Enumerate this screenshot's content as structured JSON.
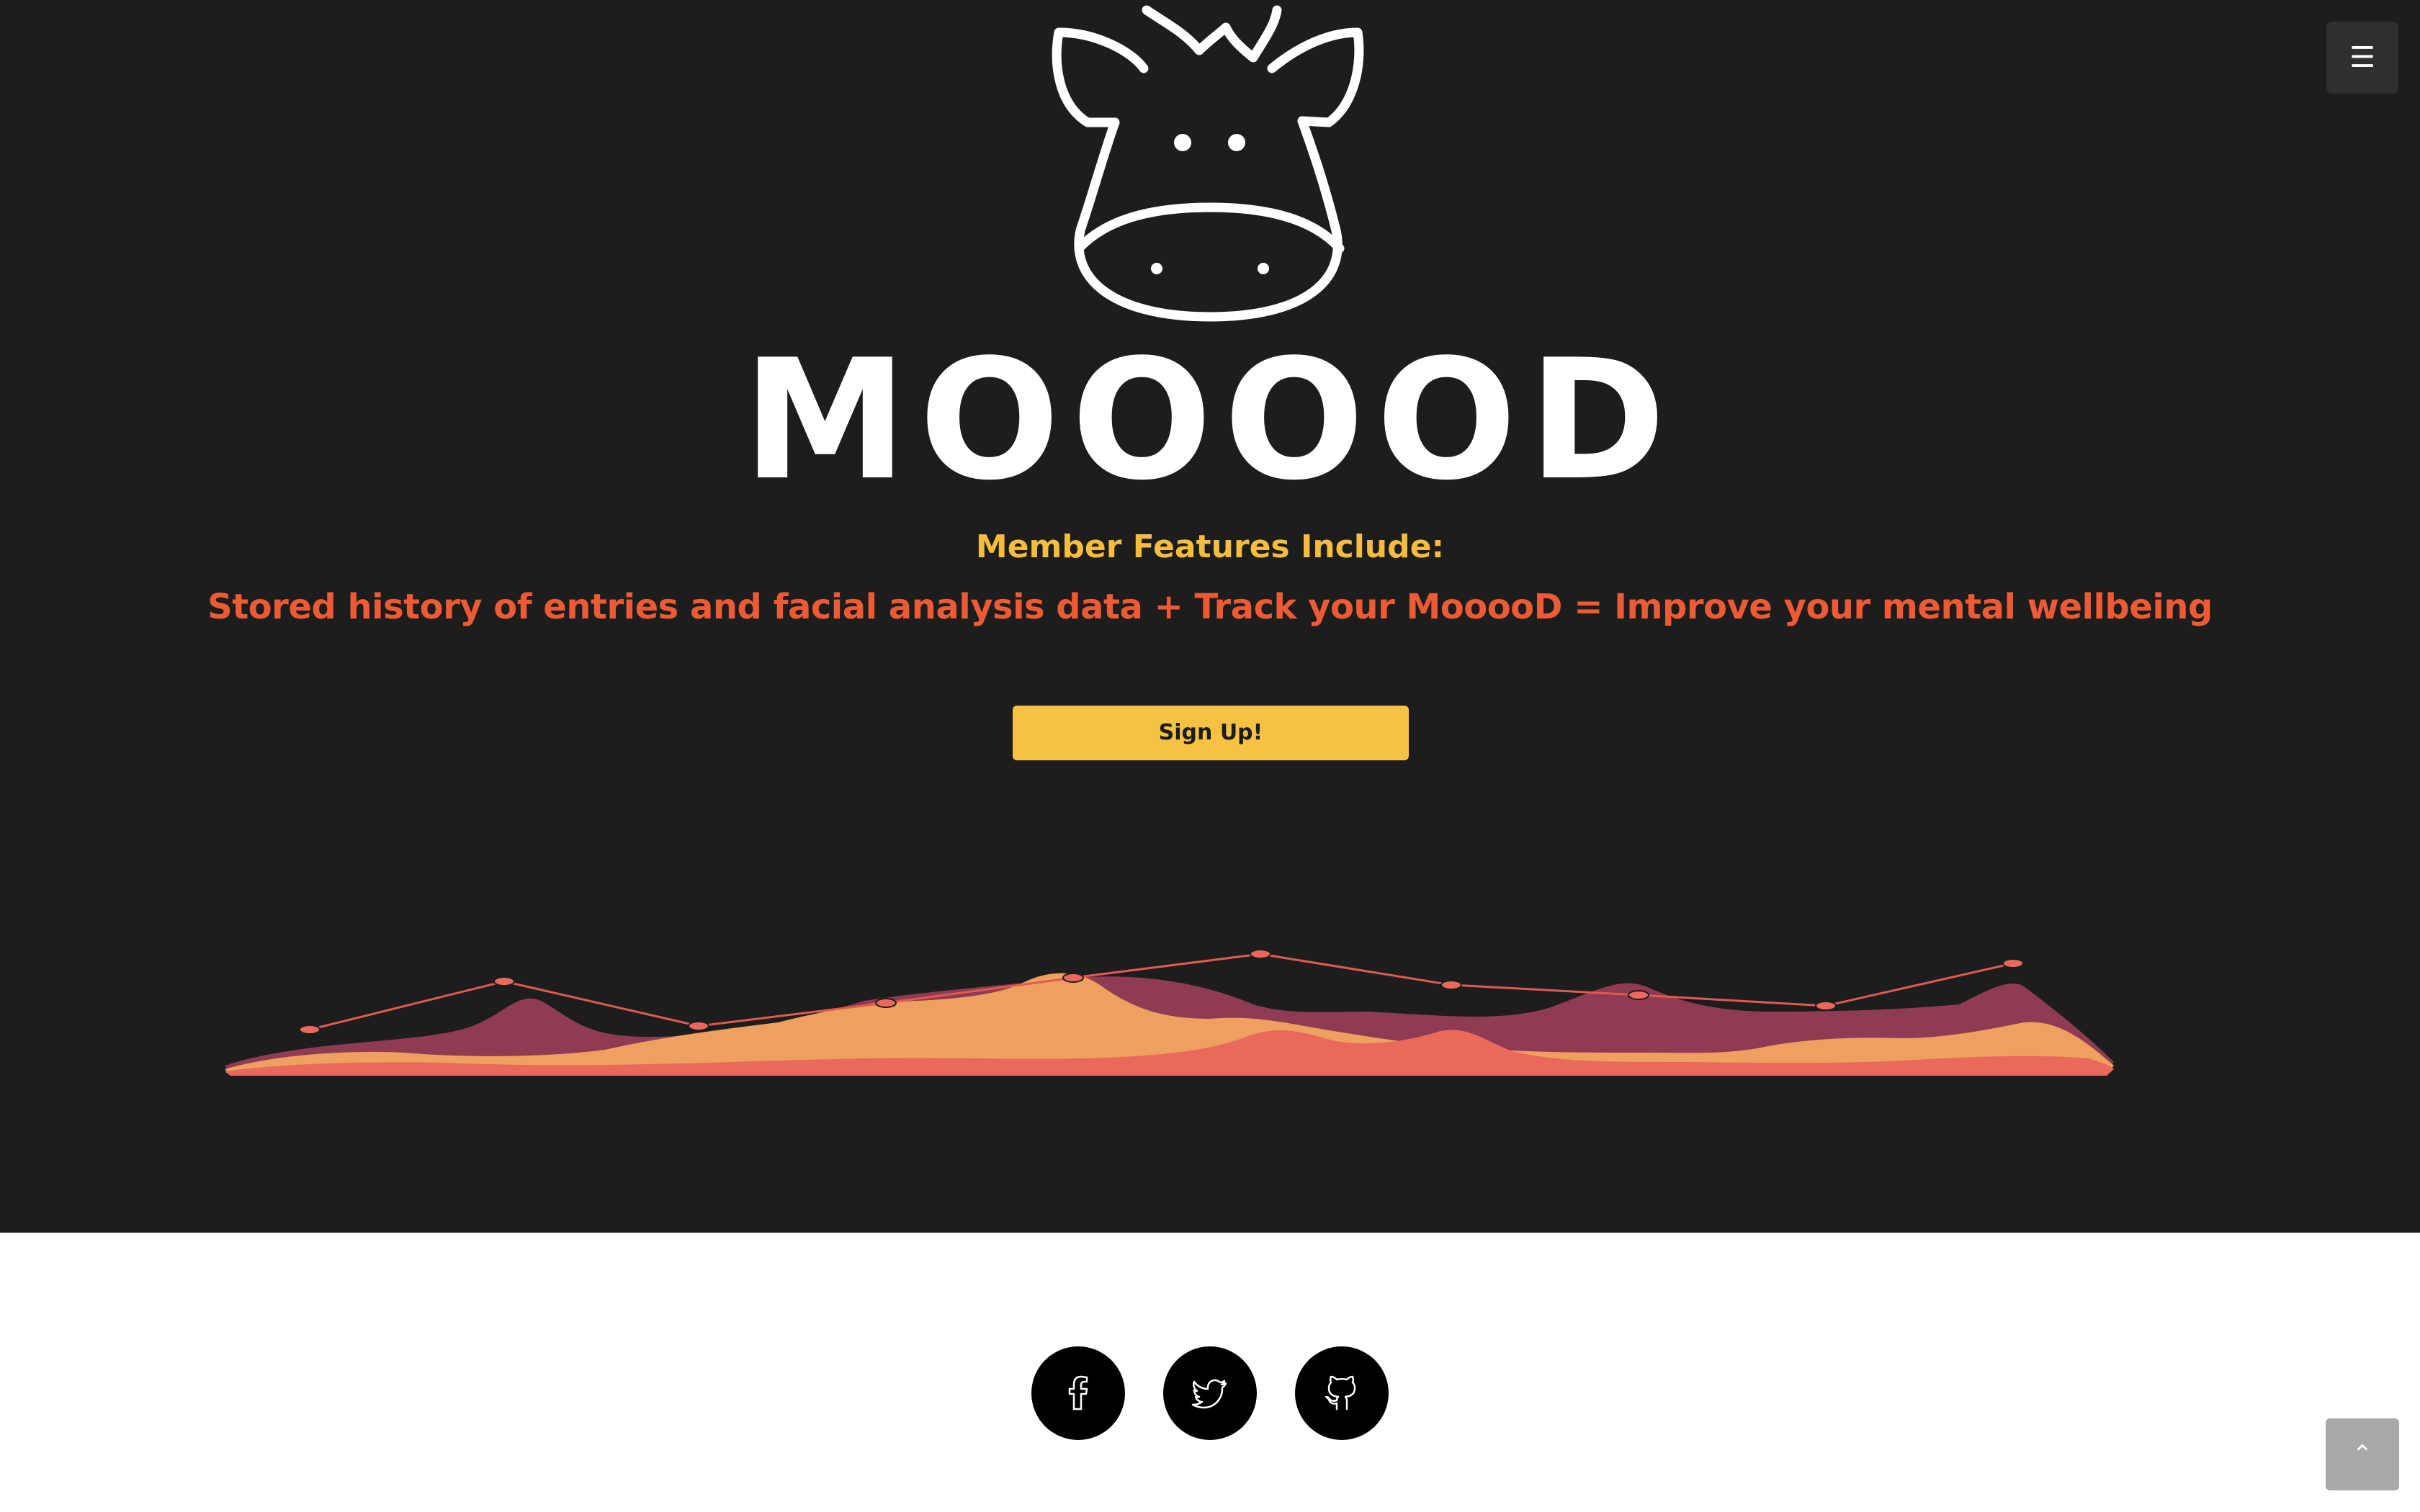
{
  "brand": {
    "name": "MOOOOD",
    "logo_icon": "cow-face-icon"
  },
  "menu": {
    "icon": "hamburger-menu-icon",
    "glyph": "☰"
  },
  "hero": {
    "features_title": "Member Features Include:",
    "features_text": "Stored history of entries and facial analysis data + Track your MooooD = Improve your mental wellbeing",
    "signup_label": "Sign Up!"
  },
  "social": [
    {
      "name": "facebook",
      "icon": "facebook-icon"
    },
    {
      "name": "twitter",
      "icon": "twitter-icon"
    },
    {
      "name": "github",
      "icon": "github-icon"
    }
  ],
  "back_to_top": {
    "icon": "chevron-up-icon",
    "glyph": "⌃"
  },
  "colors": {
    "background_dark": "#1d1d1d",
    "accent_yellow": "#f6c244",
    "accent_orange": "#ec5b35",
    "graph_maroon": "#8e3b53",
    "graph_peach": "#eda060",
    "graph_coral": "#e96a5b"
  }
}
